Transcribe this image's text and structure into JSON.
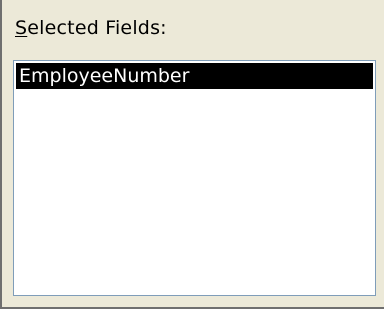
{
  "selected_fields": {
    "label_access_key": "S",
    "label_rest": "elected Fields:",
    "items": [
      {
        "label": "EmployeeNumber",
        "selected": true
      }
    ]
  }
}
